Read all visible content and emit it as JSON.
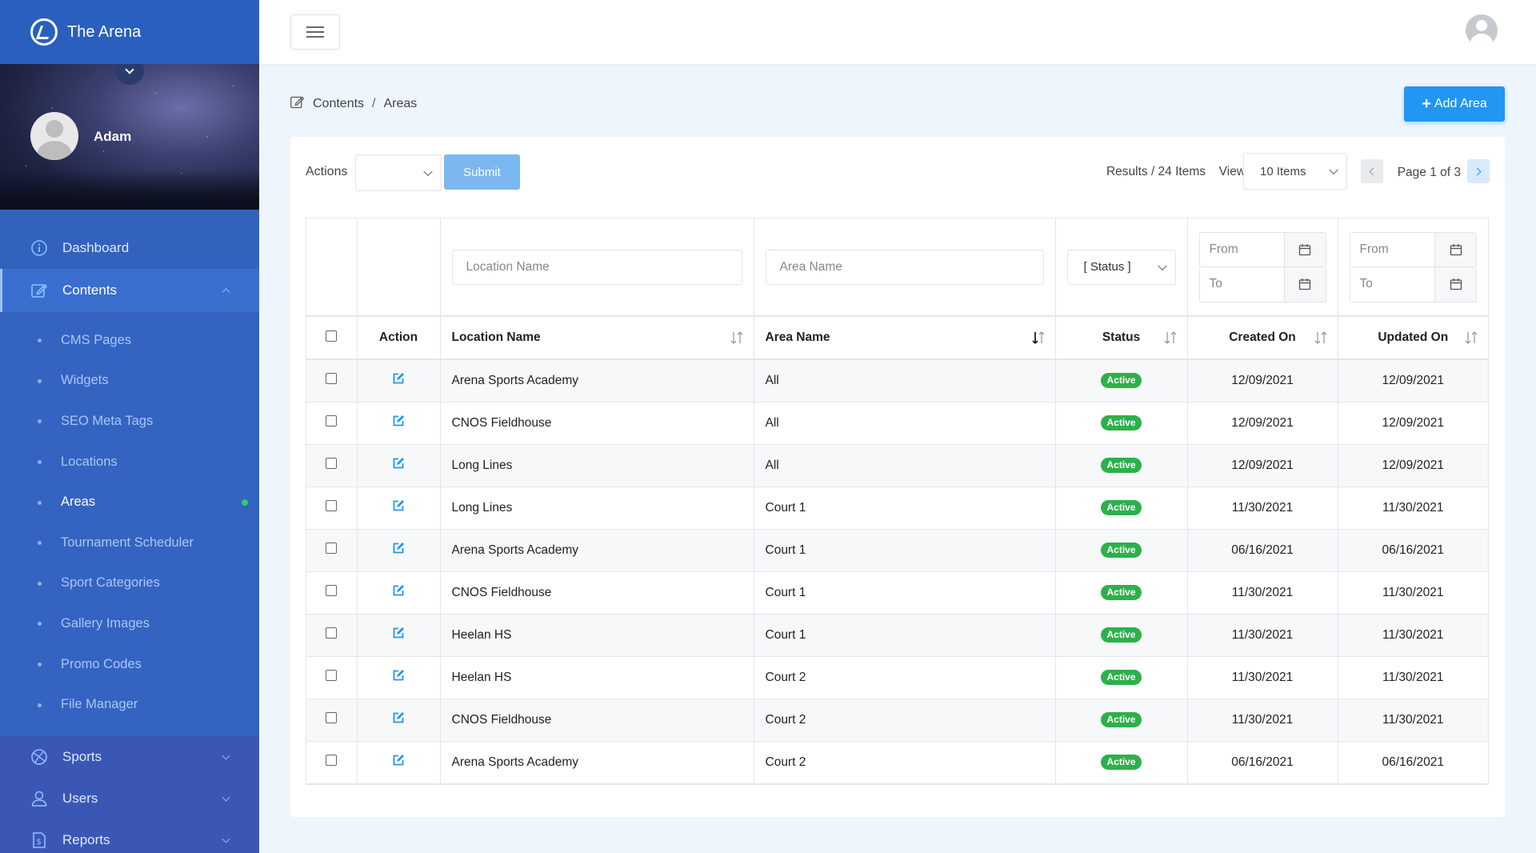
{
  "brand": {
    "name": "The Arena"
  },
  "profile": {
    "name": "Adam"
  },
  "nav": {
    "dashboard": "Dashboard",
    "contents": "Contents",
    "sub_items": [
      {
        "label": "CMS Pages"
      },
      {
        "label": "Widgets"
      },
      {
        "label": "SEO Meta Tags"
      },
      {
        "label": "Locations"
      },
      {
        "label": "Areas"
      },
      {
        "label": "Tournament Scheduler"
      },
      {
        "label": "Sport Categories"
      },
      {
        "label": "Gallery Images"
      },
      {
        "label": "Promo Codes"
      },
      {
        "label": "File Manager"
      }
    ],
    "sports": "Sports",
    "users": "Users",
    "reports": "Reports"
  },
  "breadcrumb": {
    "root": "Contents",
    "separator": "/",
    "current": "Areas"
  },
  "add_button": {
    "label": "Add Area"
  },
  "toolbar": {
    "actions_label": "Actions",
    "submit_label": "Submit",
    "results": "Results / 24 Items",
    "view_label": "View",
    "view_value": "10 Items",
    "page_label": "Page 1 of 3"
  },
  "filters": {
    "location_placeholder": "Location Name",
    "area_placeholder": "Area Name",
    "status_value": "[ Status ]",
    "from": "From",
    "to": "To"
  },
  "columns": {
    "action": "Action",
    "location": "Location Name",
    "area": "Area Name",
    "status": "Status",
    "created": "Created On",
    "updated": "Updated On"
  },
  "rows": [
    {
      "location": "Arena Sports Academy",
      "area": "All",
      "status": "Active",
      "created": "12/09/2021",
      "updated": "12/09/2021"
    },
    {
      "location": "CNOS Fieldhouse",
      "area": "All",
      "status": "Active",
      "created": "12/09/2021",
      "updated": "12/09/2021"
    },
    {
      "location": "Long Lines",
      "area": "All",
      "status": "Active",
      "created": "12/09/2021",
      "updated": "12/09/2021"
    },
    {
      "location": "Long Lines",
      "area": "Court 1",
      "status": "Active",
      "created": "11/30/2021",
      "updated": "11/30/2021"
    },
    {
      "location": "Arena Sports Academy",
      "area": "Court 1",
      "status": "Active",
      "created": "06/16/2021",
      "updated": "06/16/2021"
    },
    {
      "location": "CNOS Fieldhouse",
      "area": "Court 1",
      "status": "Active",
      "created": "11/30/2021",
      "updated": "11/30/2021"
    },
    {
      "location": "Heelan HS",
      "area": "Court 1",
      "status": "Active",
      "created": "11/30/2021",
      "updated": "11/30/2021"
    },
    {
      "location": "Heelan HS",
      "area": "Court 2",
      "status": "Active",
      "created": "11/30/2021",
      "updated": "11/30/2021"
    },
    {
      "location": "CNOS Fieldhouse",
      "area": "Court 2",
      "status": "Active",
      "created": "11/30/2021",
      "updated": "11/30/2021"
    },
    {
      "location": "Arena Sports Academy",
      "area": "Court 2",
      "status": "Active",
      "created": "06/16/2021",
      "updated": "06/16/2021"
    }
  ],
  "colors": {
    "primary": "#2196f3",
    "sidebar": "#3461bd",
    "active_badge": "#2db04b"
  },
  "icons": {
    "dashboard": "info-circle-icon",
    "contents": "edit-icon",
    "sports": "ball-icon",
    "users": "user-icon",
    "reports": "file-dollar-icon",
    "row_action": "edit-icon",
    "calendar": "calendar-icon"
  }
}
